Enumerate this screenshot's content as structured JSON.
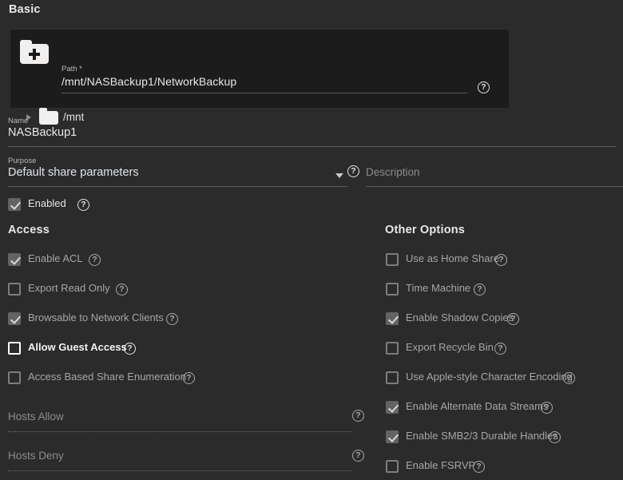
{
  "sections": {
    "basic": "Basic",
    "access": "Access",
    "other_options": "Other Options"
  },
  "path_panel": {
    "icon": "folder-add-icon",
    "label": "Path *",
    "value": "/mnt/NASBackup1/NetworkBackup",
    "help": "?",
    "tree": {
      "caret": "chevron-right-icon",
      "folder_icon": "folder-icon",
      "name": "/mnt"
    }
  },
  "name_field": {
    "label": "Name",
    "value": "NASBackup1"
  },
  "purpose_field": {
    "label": "Purpose",
    "value": "Default share parameters",
    "caret": "chevron-down-icon",
    "help": "?"
  },
  "description_field": {
    "placeholder": "Description"
  },
  "enabled_row": {
    "label": "Enabled",
    "checked": true,
    "help": "?"
  },
  "access_options": [
    {
      "label": "Enable ACL",
      "checked": true,
      "help": "?",
      "state": "dim"
    },
    {
      "label": "Export Read Only",
      "checked": false,
      "help": "?",
      "state": "dim"
    },
    {
      "label": "Browsable to Network Clients",
      "checked": true,
      "help": "?",
      "state": "dim"
    },
    {
      "label": "Allow Guest Access",
      "checked": false,
      "help": "?",
      "state": "focused"
    },
    {
      "label": "Access Based Share Enumeration",
      "checked": false,
      "help": "?",
      "state": "dim"
    }
  ],
  "other_options_list": [
    {
      "label": "Use as Home Share",
      "checked": false,
      "help": "?",
      "state": "dim"
    },
    {
      "label": "Time Machine",
      "checked": false,
      "help": "?",
      "state": "dim"
    },
    {
      "label": "Enable Shadow Copies",
      "checked": true,
      "help": "?",
      "state": "dim"
    },
    {
      "label": "Export Recycle Bin",
      "checked": false,
      "help": "?",
      "state": "dim"
    },
    {
      "label": "Use Apple-style Character Encoding",
      "checked": false,
      "help": "?",
      "state": "dim"
    },
    {
      "label": "Enable Alternate Data Streams",
      "checked": true,
      "help": "?",
      "state": "dim"
    },
    {
      "label": "Enable SMB2/3 Durable Handles",
      "checked": true,
      "help": "?",
      "state": "dim"
    },
    {
      "label": "Enable FSRVP",
      "checked": false,
      "help": "?",
      "state": "dim"
    }
  ],
  "hosts_allow": {
    "placeholder": "Hosts Allow",
    "help": "?"
  },
  "hosts_deny": {
    "placeholder": "Hosts Deny",
    "help": "?"
  },
  "colors": {
    "page_bg": "#2b2b2b",
    "panel_bg": "#1c1c1c",
    "text": "#d6d6d6",
    "muted": "#a6a6a6",
    "bright": "#f2f2f2",
    "underline": "#5b5b5b"
  }
}
